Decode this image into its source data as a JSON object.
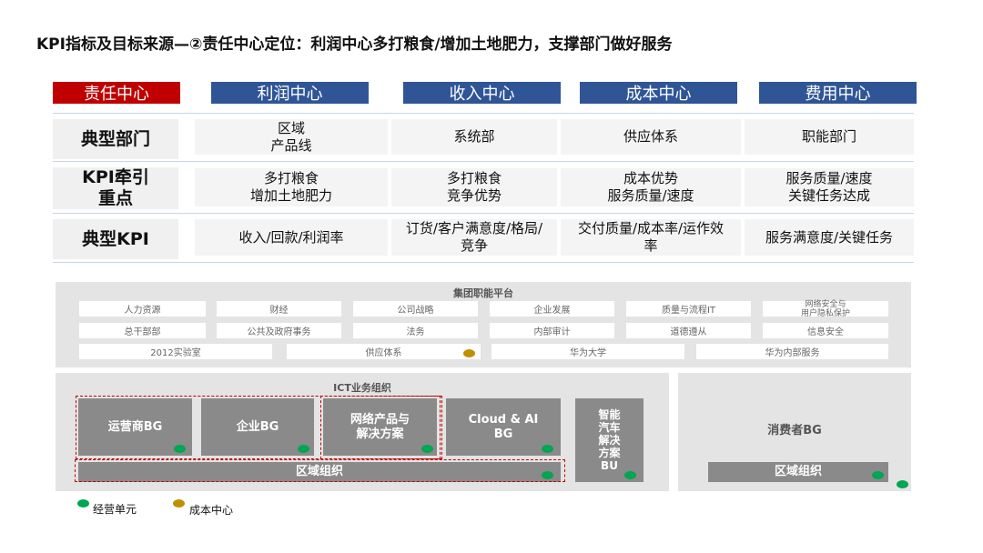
{
  "title": "KPI指标及目标来源—②责任中心定位：利润中心多打粮食/增加土地肥力，支撑部门做好服务",
  "colors": {
    "accent_red": "#c00000",
    "header_blue": "#2f5597",
    "business_unit": "#00a651",
    "cost_center": "#bf9000"
  },
  "table": {
    "corner_label": "责任中心",
    "columns": [
      "利润中心",
      "收入中心",
      "成本中心",
      "费用中心"
    ],
    "rows": [
      {
        "label": "典型部门",
        "cells": [
          "区域\n产品线",
          "系统部",
          "供应体系",
          "职能部门"
        ]
      },
      {
        "label": "KPI牵引\n重点",
        "cells": [
          "多打粮食\n增加土地肥力",
          "多打粮食\n竞争优势",
          "成本优势\n服务质量/速度",
          "服务质量/速度\n关键任务达成"
        ]
      },
      {
        "label": "典型KPI",
        "cells": [
          "收入/回款/利润率",
          "订货/客户满意度/格局/\n竞争",
          "交付质量/成本率/运作效\n率",
          "服务满意度/关键任务"
        ]
      }
    ]
  },
  "org": {
    "platform": {
      "title": "集团职能平台",
      "row1": [
        "人力资源",
        "财经",
        "公司战略",
        "企业发展",
        "质量与流程IT",
        "网络安全与\n用户隐私保护"
      ],
      "row2": [
        "总干部部",
        "公共及政府事务",
        "法务",
        "内部审计",
        "道德遵从",
        "信息安全"
      ],
      "row3": [
        "2012实验室",
        "供应体系",
        "华为大学",
        "华为内部服务"
      ]
    },
    "ict": {
      "title": "ICT业务组织",
      "units": [
        "运营商BG",
        "企业BG",
        "网络产品与\n解决方案",
        "Cloud & AI\nBG",
        "智能\n汽车\n解决\n方案\nBU"
      ],
      "region": "区域组织"
    },
    "consumer": {
      "unit": "消费者BG",
      "region": "区域组织"
    }
  },
  "legend": [
    {
      "label": "经营单元",
      "color": "#00a651"
    },
    {
      "label": "成本中心",
      "color": "#bf9000"
    }
  ]
}
